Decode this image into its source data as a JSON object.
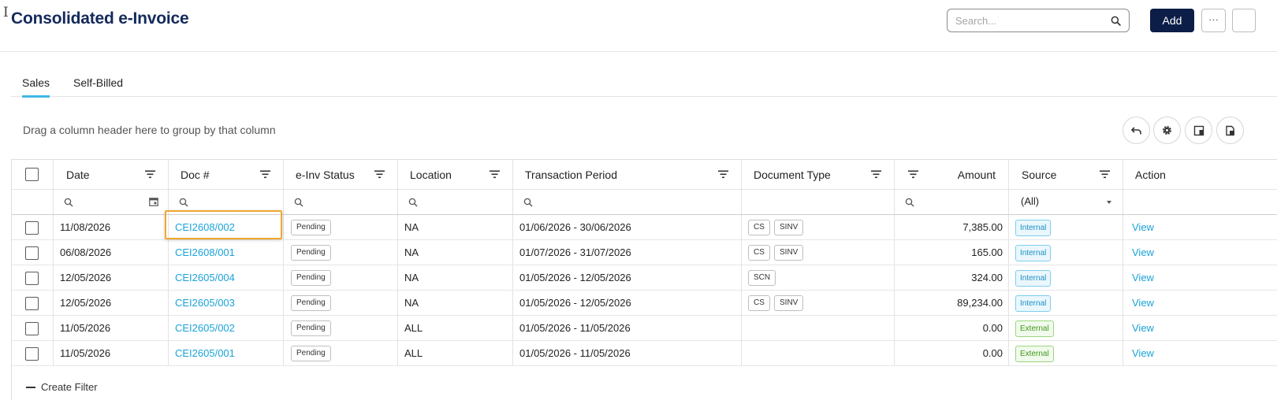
{
  "header": {
    "title": "Consolidated e-Invoice",
    "search_placeholder": "Search...",
    "add_label": "Add",
    "more_label": "···"
  },
  "tabs": [
    {
      "label": "Sales",
      "active": true
    },
    {
      "label": "Self-Billed",
      "active": false
    }
  ],
  "toolbar": {
    "group_hint": "Drag a column header here to group by that column",
    "icons": [
      "undo-icon",
      "gear-icon",
      "column-chooser-icon",
      "export-icon"
    ]
  },
  "grid": {
    "columns": [
      "Date",
      "Doc #",
      "e-Inv Status",
      "Location",
      "Transaction Period",
      "Document Type",
      "Amount",
      "Source",
      "Action"
    ],
    "source_filter_value": "(All)",
    "rows": [
      {
        "date": "11/08/2026",
        "doc": "CEI2608/002",
        "status": "Pending",
        "location": "NA",
        "period": "01/06/2026 - 30/06/2026",
        "doc_types": [
          "CS",
          "SINV"
        ],
        "amount": "7,385.00",
        "source": "Internal",
        "action": "View"
      },
      {
        "date": "06/08/2026",
        "doc": "CEI2608/001",
        "status": "Pending",
        "location": "NA",
        "period": "01/07/2026 - 31/07/2026",
        "doc_types": [
          "CS",
          "SINV"
        ],
        "amount": "165.00",
        "source": "Internal",
        "action": "View"
      },
      {
        "date": "12/05/2026",
        "doc": "CEI2605/004",
        "status": "Pending",
        "location": "NA",
        "period": "01/05/2026 - 12/05/2026",
        "doc_types": [
          "SCN"
        ],
        "amount": "324.00",
        "source": "Internal",
        "action": "View"
      },
      {
        "date": "12/05/2026",
        "doc": "CEI2605/003",
        "status": "Pending",
        "location": "NA",
        "period": "01/05/2026 - 12/05/2026",
        "doc_types": [
          "CS",
          "SINV"
        ],
        "amount": "89,234.00",
        "source": "Internal",
        "action": "View"
      },
      {
        "date": "11/05/2026",
        "doc": "CEI2605/002",
        "status": "Pending",
        "location": "ALL",
        "period": "01/05/2026 - 11/05/2026",
        "doc_types": [],
        "amount": "0.00",
        "source": "External",
        "action": "View"
      },
      {
        "date": "11/05/2026",
        "doc": "CEI2605/001",
        "status": "Pending",
        "location": "ALL",
        "period": "01/05/2026 - 11/05/2026",
        "doc_types": [],
        "amount": "0.00",
        "source": "External",
        "action": "View"
      }
    ]
  },
  "footer": {
    "create_filter_label": "Create Filter"
  },
  "colors": {
    "title": "#142a5c",
    "primary_button": "#0c1d47",
    "link": "#1aa3d9",
    "tab_indicator": "#41b7e6",
    "highlight": "#f0a830",
    "internal": "#1d8fc5",
    "external": "#3f9a1c"
  }
}
